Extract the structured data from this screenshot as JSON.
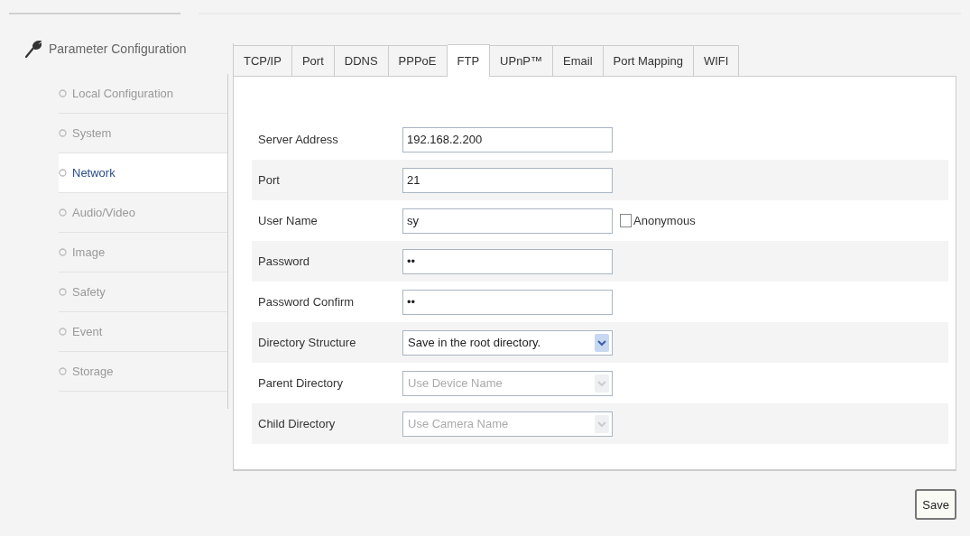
{
  "sidebar": {
    "title": "Parameter Configuration",
    "items": [
      {
        "label": "Local Configuration",
        "selected": false
      },
      {
        "label": "System",
        "selected": false
      },
      {
        "label": "Network",
        "selected": true
      },
      {
        "label": "Audio/Video",
        "selected": false
      },
      {
        "label": "Image",
        "selected": false
      },
      {
        "label": "Safety",
        "selected": false
      },
      {
        "label": "Event",
        "selected": false
      },
      {
        "label": "Storage",
        "selected": false
      }
    ]
  },
  "tabs": [
    {
      "label": "TCP/IP",
      "selected": false
    },
    {
      "label": "Port",
      "selected": false
    },
    {
      "label": "DDNS",
      "selected": false
    },
    {
      "label": "PPPoE",
      "selected": false
    },
    {
      "label": "FTP",
      "selected": true
    },
    {
      "label": "UPnP™",
      "selected": false
    },
    {
      "label": "Email",
      "selected": false
    },
    {
      "label": "Port Mapping",
      "selected": false
    },
    {
      "label": "WIFI",
      "selected": false
    }
  ],
  "form": [
    {
      "label": "Server Address",
      "kind": "text",
      "value": "192.168.2.200"
    },
    {
      "label": "Port",
      "kind": "text",
      "value": "21"
    },
    {
      "label": "User Name",
      "kind": "text",
      "value": "sy",
      "option": {
        "label": "Anonymous",
        "checked": false
      }
    },
    {
      "label": "Password",
      "kind": "text",
      "value": "••"
    },
    {
      "label": "Password Confirm",
      "kind": "text",
      "value": "••"
    },
    {
      "label": "Directory Structure",
      "kind": "select",
      "value": "Save in the root directory.",
      "disabled": false
    },
    {
      "label": "Parent Directory",
      "kind": "select",
      "value": "Use Device Name",
      "disabled": true
    },
    {
      "label": "Child Directory",
      "kind": "select",
      "value": "Use Camera Name",
      "disabled": true
    }
  ],
  "save_button": "Save"
}
